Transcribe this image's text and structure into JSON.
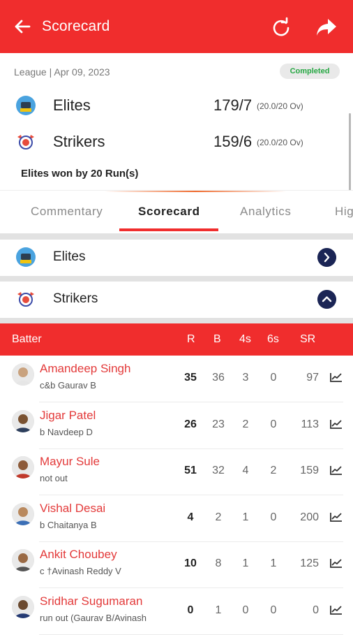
{
  "header": {
    "title": "Scorecard",
    "back_icon": "arrow-left-icon",
    "refresh_icon": "refresh-icon",
    "share_icon": "share-icon",
    "color": "#f02d2d"
  },
  "match": {
    "meta": "League | Apr 09, 2023",
    "status": "Completed",
    "teams": [
      {
        "name": "Elites",
        "score": "179/7",
        "overs": "(20.0/20 Ov)"
      },
      {
        "name": "Strikers",
        "score": "159/6",
        "overs": "(20.0/20 Ov)"
      }
    ],
    "result": "Elites won by 20 Run(s)"
  },
  "tabs": [
    {
      "label": "Commentary"
    },
    {
      "label": "Scorecard"
    },
    {
      "label": "Analytics"
    },
    {
      "label": "Hig"
    }
  ],
  "innings": [
    {
      "team": "Elites",
      "expanded": false
    },
    {
      "team": "Strikers",
      "expanded": true
    }
  ],
  "batting": {
    "columns": [
      "Batter",
      "R",
      "B",
      "4s",
      "6s",
      "SR"
    ],
    "rows": [
      {
        "name": "Amandeep Singh",
        "dismissal": "c&b Gaurav B",
        "r": "35",
        "b": "36",
        "fours": "3",
        "sixes": "0",
        "sr": "97"
      },
      {
        "name": "Jigar Patel",
        "dismissal": "b Navdeep D",
        "r": "26",
        "b": "23",
        "fours": "2",
        "sixes": "0",
        "sr": "113"
      },
      {
        "name": "Mayur Sule",
        "dismissal": "not out",
        "r": "51",
        "b": "32",
        "fours": "4",
        "sixes": "2",
        "sr": "159"
      },
      {
        "name": "Vishal Desai",
        "dismissal": "b Chaitanya B",
        "r": "4",
        "b": "2",
        "fours": "1",
        "sixes": "0",
        "sr": "200"
      },
      {
        "name": "Ankit Choubey",
        "dismissal": "c †Avinash Reddy V",
        "r": "10",
        "b": "8",
        "fours": "1",
        "sixes": "1",
        "sr": "125"
      },
      {
        "name": "Sridhar Sugumaran",
        "dismissal": "run out (Gaurav B/Avinash",
        "r": "0",
        "b": "1",
        "fours": "0",
        "sixes": "0",
        "sr": "0"
      }
    ]
  }
}
